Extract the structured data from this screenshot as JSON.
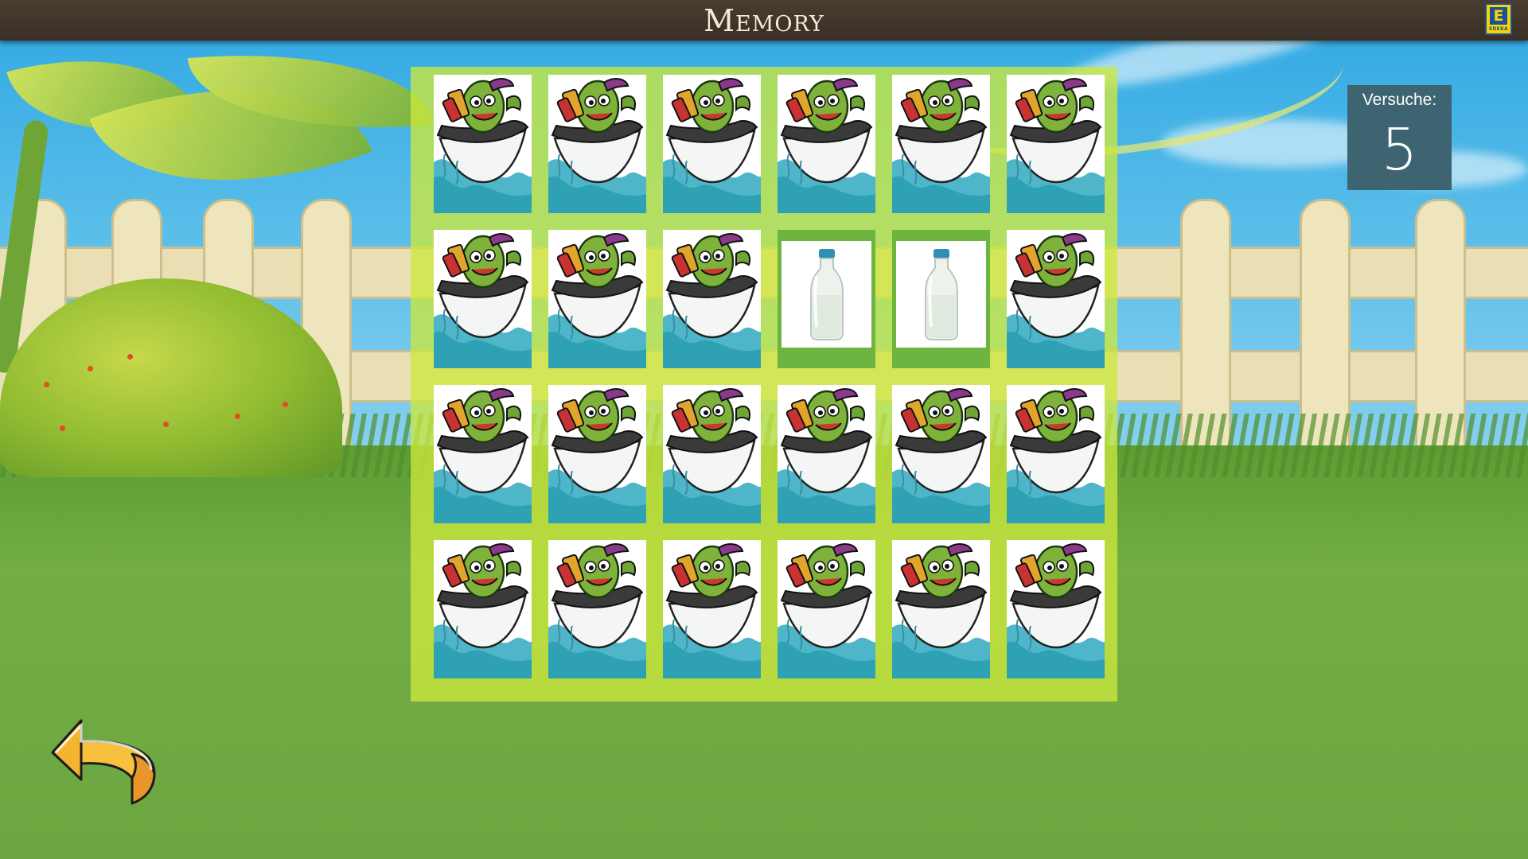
{
  "header": {
    "title": "Memory",
    "logo_text": "EDEKA",
    "logo_letter": "E"
  },
  "counter": {
    "label": "Versuche:",
    "value": "5"
  },
  "board": {
    "rows": 4,
    "columns": 6,
    "cards": [
      "hidden",
      "hidden",
      "hidden",
      "hidden",
      "hidden",
      "hidden",
      "hidden",
      "hidden",
      "hidden",
      "milk-bottle",
      "milk-bottle",
      "hidden",
      "hidden",
      "hidden",
      "hidden",
      "hidden",
      "hidden",
      "hidden",
      "hidden",
      "hidden",
      "hidden",
      "hidden",
      "hidden",
      "hidden"
    ],
    "card_back_icon": "cucumber-bathtub-icon",
    "open_card_icon": "milk-bottle-icon"
  },
  "icons": {
    "back_button": "curved-back-arrow-icon"
  },
  "colors": {
    "board": "#cce83e",
    "open_card_frame": "#6db540",
    "counter_bg": "#3d6470",
    "header_bg": "#3f332a",
    "arrow_fill": "#f7c13e",
    "logo_yellow": "#f6d500",
    "logo_blue": "#1d4f9c"
  }
}
